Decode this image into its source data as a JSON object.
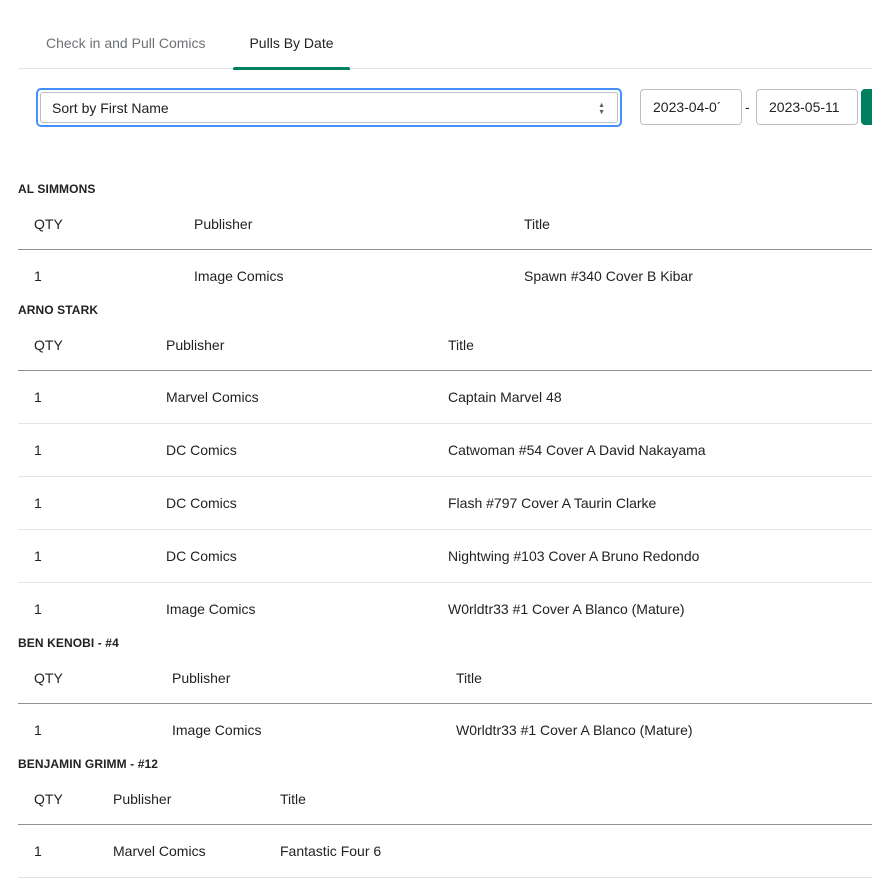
{
  "tabs": [
    {
      "label": "Check in and Pull Comics"
    },
    {
      "label": "Pulls By Date"
    }
  ],
  "sort": {
    "value": "Sort by First Name"
  },
  "date_range": {
    "start": "2023-04-0´",
    "separator": "-",
    "end": "2023-05-11"
  },
  "groups": [
    {
      "name": "AL SIMMONS",
      "headers": {
        "qty": "QTY",
        "publisher": "Publisher",
        "title": "Title"
      },
      "rows": [
        {
          "qty": "1",
          "publisher": "Image Comics",
          "title": "Spawn #340 Cover B Kibar"
        }
      ]
    },
    {
      "name": "ARNO STARK",
      "headers": {
        "qty": "QTY",
        "publisher": "Publisher",
        "title": "Title"
      },
      "rows": [
        {
          "qty": "1",
          "publisher": "Marvel Comics",
          "title": "Captain Marvel 48"
        },
        {
          "qty": "1",
          "publisher": "DC Comics",
          "title": "Catwoman #54 Cover A David Nakayama"
        },
        {
          "qty": "1",
          "publisher": "DC Comics",
          "title": "Flash #797 Cover A Taurin Clarke"
        },
        {
          "qty": "1",
          "publisher": "DC Comics",
          "title": "Nightwing #103 Cover A Bruno Redondo"
        },
        {
          "qty": "1",
          "publisher": "Image Comics",
          "title": "W0rldtr33 #1 Cover A Blanco (Mature)"
        }
      ]
    },
    {
      "name": "BEN KENOBI - #4",
      "headers": {
        "qty": "QTY",
        "publisher": "Publisher",
        "title": "Title"
      },
      "rows": [
        {
          "qty": "1",
          "publisher": "Image Comics",
          "title": "W0rldtr33 #1 Cover A Blanco (Mature)"
        }
      ]
    },
    {
      "name": "BENJAMIN GRIMM - #12",
      "headers": {
        "qty": "QTY",
        "publisher": "Publisher",
        "title": "Title"
      },
      "rows": [
        {
          "qty": "1",
          "publisher": "Marvel Comics",
          "title": "Fantastic Four 6"
        }
      ]
    }
  ],
  "colors": {
    "accent": "#008060",
    "focus": "#458fff"
  },
  "icons": {
    "select": "select-caret-icon"
  }
}
